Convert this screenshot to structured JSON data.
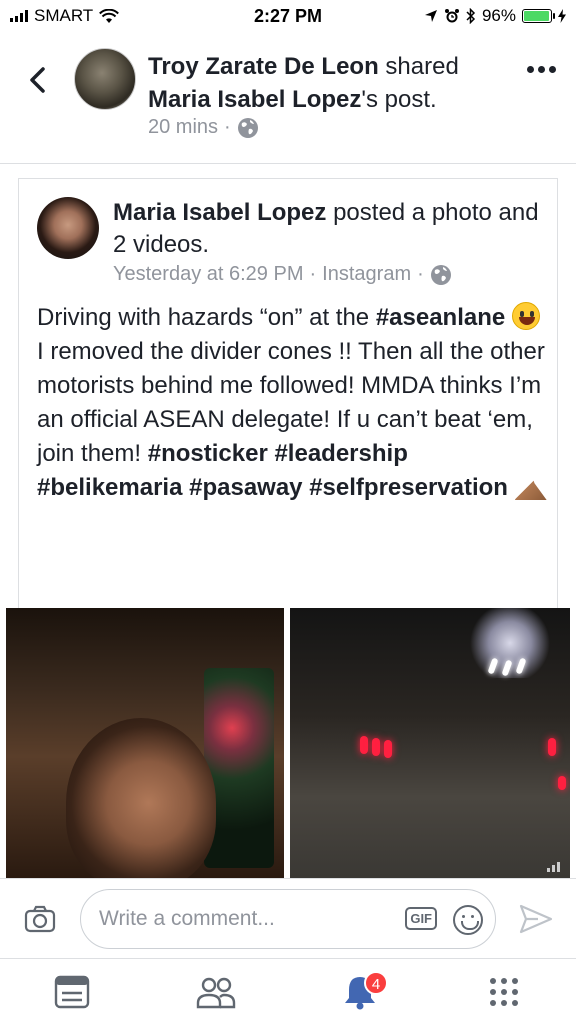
{
  "status_bar": {
    "carrier": "SMART",
    "time": "2:27 PM",
    "battery_percent": "96%",
    "battery_level": 0.96,
    "icons": [
      "signal-icon",
      "wifi-icon",
      "location-icon",
      "alarm-icon",
      "bluetooth-icon",
      "battery-icon",
      "charging-icon"
    ]
  },
  "header": {
    "sharer_name": "Troy Zarate De Leon",
    "shared_text": " shared ",
    "original_author_possessive": "Maria Isabel Lopez",
    "post_suffix": "'s post.",
    "time_ago": "20 mins",
    "separator": "·",
    "privacy_icon": "globe-icon"
  },
  "shared_post": {
    "author": "Maria Isabel Lopez",
    "action": " posted a photo and 2 videos.",
    "timestamp": "Yesterday at 6:29 PM",
    "separator": "·",
    "source": "Instagram",
    "separator2": "·",
    "privacy_icon": "globe-icon",
    "text": {
      "p1": "Driving with hazards “on” at the ",
      "tag1": "#aseanlane",
      "p2": " I removed the divider cones !! Then all the other motorists behind me followed! MMDA thinks I’m an official ASEAN delegate! If u can’t beat ‘em, join them! ",
      "tag2": "#nosticker",
      "tag3": "#leadership",
      "tag4": "#belikemaria",
      "tag5": "#pasaway",
      "tag6": "#selfpreservation",
      "space": " "
    }
  },
  "media": [
    {
      "type": "photo"
    },
    {
      "type": "video"
    }
  ],
  "comment_bar": {
    "placeholder": "Write a comment...",
    "gif_label": "GIF"
  },
  "bottom_nav": {
    "items": [
      {
        "name": "news-feed",
        "icon": "newsfeed-icon"
      },
      {
        "name": "friends",
        "icon": "friends-icon"
      },
      {
        "name": "notifications",
        "icon": "bell-icon",
        "badge": "4"
      },
      {
        "name": "menu",
        "icon": "grid-menu-icon"
      }
    ]
  },
  "colors": {
    "text_primary": "#1d2129",
    "text_secondary": "#90949c",
    "accent_blue": "#4267b2",
    "badge_red": "#fa3e3e",
    "battery_green": "#4cd964"
  }
}
